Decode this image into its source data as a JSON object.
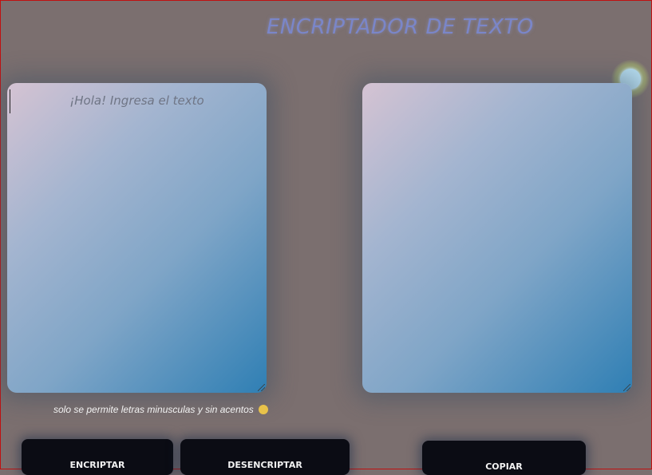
{
  "header": {
    "title": "ENCRIPTADOR DE TEXTO"
  },
  "input_area": {
    "placeholder": "¡Hola! Ingresa el texto",
    "value": ""
  },
  "output_area": {
    "value": ""
  },
  "hint": {
    "text": "solo se permite letras minusculas y sin acentos"
  },
  "buttons": {
    "encrypt_label": "ENCRIPTAR",
    "decrypt_label": "DESENCRIPTAR",
    "copy_label": "COPIAR"
  },
  "icons": {
    "hint_emoji": "smiling-face-icon",
    "orb": "glowing-orb-icon"
  },
  "colors": {
    "background": "#7b6f6f",
    "title": "#7a86c9",
    "button_bg": "#0b0c14",
    "panel_gradient_start": "#d5c3d3",
    "panel_gradient_end": "#2f7fb4"
  }
}
